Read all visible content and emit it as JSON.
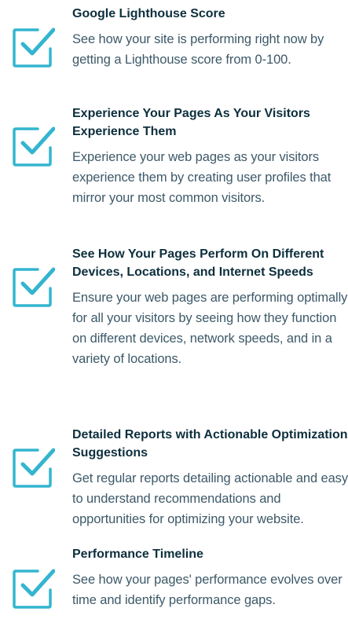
{
  "accent_color": "#33b5cf",
  "features": [
    {
      "icon": "checkbox-check-icon",
      "title": "Google Lighthouse Score",
      "description": "See how your site is performing right now by getting a Lighthouse score from 0-100."
    },
    {
      "icon": "checkbox-check-icon",
      "title": "Experience Your Pages As Your Visitors Experience Them",
      "description": "Experience your web pages as your visitors experience them by creating user profiles that mirror your most common visitors."
    },
    {
      "icon": "checkbox-check-icon",
      "title": "See How Your Pages Perform On Different Devices, Locations, and Internet Speeds",
      "description": "Ensure your web pages are performing optimally for all your visitors by seeing how they function on different devices, network speeds, and in a variety of locations."
    },
    {
      "icon": "checkbox-check-icon",
      "title": "Detailed Reports with Actionable Optimization Suggestions",
      "description": "Get regular reports detailing actionable and easy to understand recommendations and opportunities for optimizing your website."
    },
    {
      "icon": "checkbox-check-icon",
      "title": "Performance Timeline",
      "description": "See how your pages' performance evolves over time and identify performance gaps."
    }
  ]
}
